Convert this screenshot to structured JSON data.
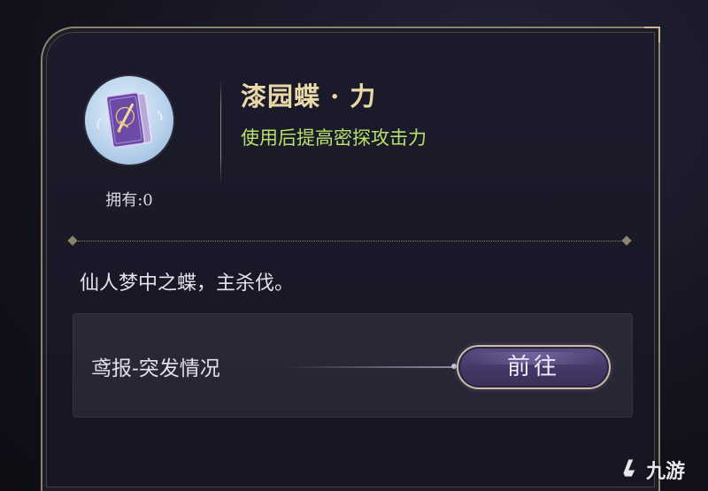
{
  "item": {
    "name": "漆园蝶 · 力",
    "effect": "使用后提高密探攻击力",
    "owned_label": "拥有:0",
    "icon": "purple-card-with-sword-icon"
  },
  "description": "仙人梦中之蝶，主杀伐。",
  "source": {
    "label": "鸢报-突发情况",
    "button_label": "前往"
  },
  "watermark": {
    "text": "九游",
    "icon": "9you-logo-icon"
  },
  "colors": {
    "name_gold": "#ead9a8",
    "effect_green": "#b7e06b",
    "button_purple": "#433766",
    "border_gold": "#8b826c"
  }
}
